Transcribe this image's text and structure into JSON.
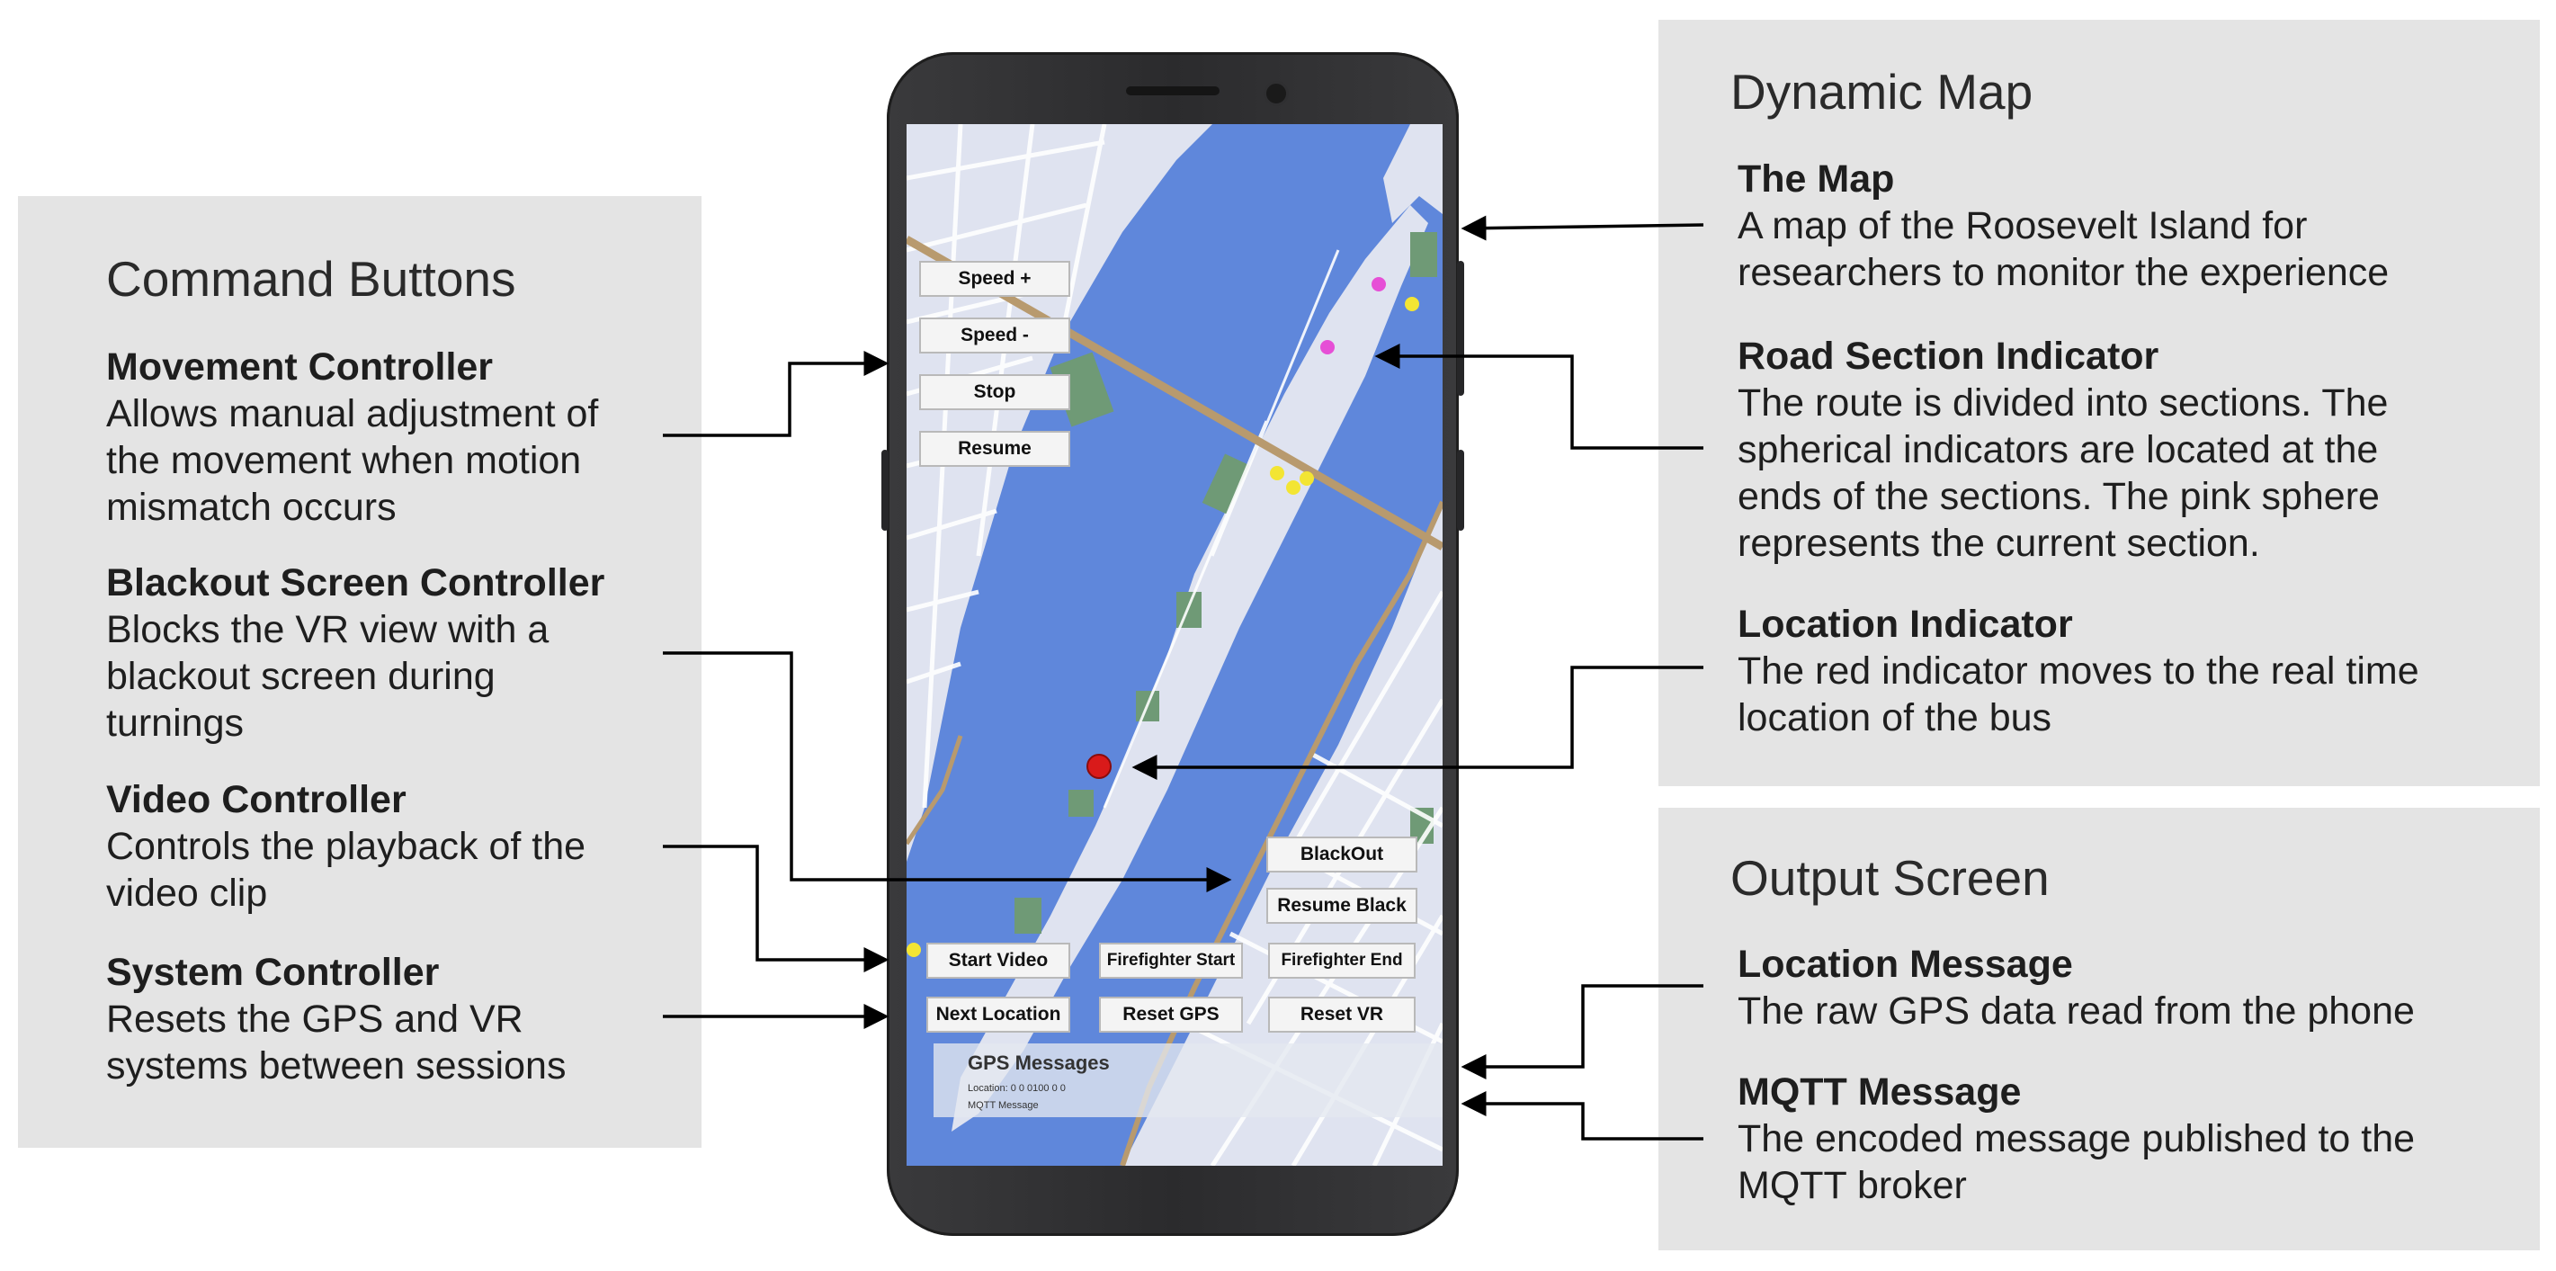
{
  "left_panel": {
    "title": "Command Buttons",
    "items": [
      {
        "title": "Movement Controller",
        "desc": "Allows manual adjustment of\nthe movement when motion\nmismatch occurs"
      },
      {
        "title": "Blackout Screen Controller",
        "desc": "Blocks the VR view with a\nblackout screen during\nturnings"
      },
      {
        "title": "Video Controller",
        "desc": "Controls the playback of the\nvideo clip"
      },
      {
        "title": "System Controller",
        "desc": "Resets the GPS and VR\nsystems between sessions"
      }
    ]
  },
  "right_top_panel": {
    "title": "Dynamic Map",
    "items": [
      {
        "title": "The Map",
        "desc": "A map of the Roosevelt Island for\nresearchers to monitor the experience"
      },
      {
        "title": "Road Section Indicator",
        "desc": "The route is divided into sections. The\nspherical indicators are located at the\nends of the sections. The pink sphere\nrepresents the current section."
      },
      {
        "title": "Location Indicator",
        "desc": "The red indicator moves to the real time\nlocation of the bus"
      }
    ]
  },
  "right_bottom_panel": {
    "title": "Output Screen",
    "items": [
      {
        "title": "Location Message",
        "desc": "The raw GPS data read from the phone"
      },
      {
        "title": "MQTT Message",
        "desc": "The encoded message published to the\nMQTT broker"
      }
    ]
  },
  "app": {
    "buttons": {
      "speed_plus": "Speed +",
      "speed_minus": "Speed -",
      "stop": "Stop",
      "resume": "Resume",
      "blackout": "BlackOut",
      "resume_black": "Resume Black",
      "start_video": "Start Video",
      "firefighter_start": "Firefighter Start",
      "firefighter_end": "Firefighter End",
      "next_location": "Next Location",
      "reset_gps": "Reset GPS",
      "reset_vr": "Reset VR"
    },
    "gps_messages": {
      "title": "GPS Messages",
      "location": "Location: 0 0 0100 0 0",
      "mqtt": "MQTT Message"
    }
  },
  "colors": {
    "panel_bg": "#e4e4e4",
    "water": "#5f87db",
    "land": "#dfe3f0",
    "park": "#6f9a76",
    "road": "#b89a6e",
    "current_section_marker": "#e64fd6",
    "section_marker": "#f3e533",
    "location_marker": "#d91a1a"
  }
}
